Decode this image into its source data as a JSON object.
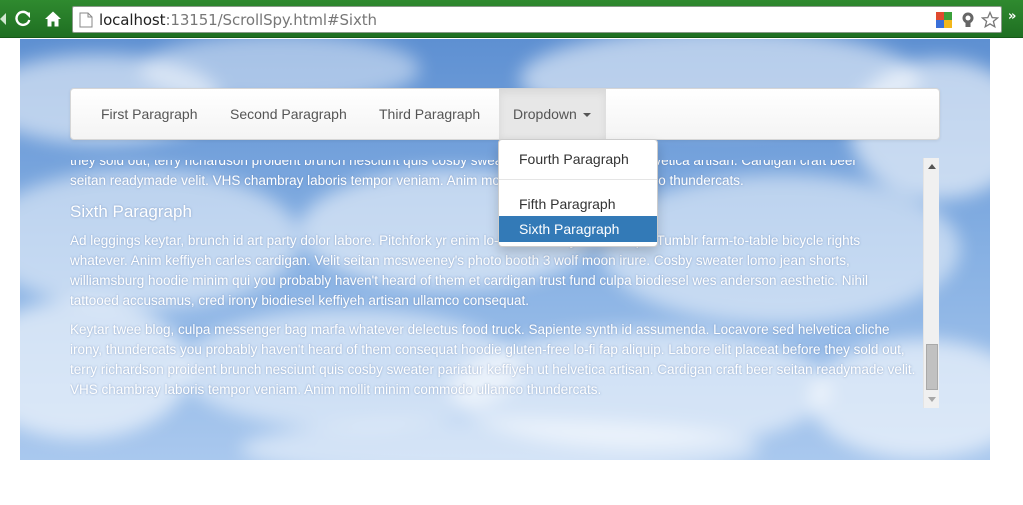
{
  "browser": {
    "url_host": "localhost",
    "url_rest": ":13151/ScrollSpy.html#Sixth",
    "more_label": "»"
  },
  "navbar": {
    "items": [
      {
        "label": "First Paragraph"
      },
      {
        "label": "Second Paragraph"
      },
      {
        "label": "Third Paragraph"
      }
    ],
    "dropdown": {
      "label": "Dropdown",
      "items": [
        {
          "label": "Fourth Paragraph",
          "active": false
        },
        {
          "label": "Fifth Paragraph",
          "active": false
        },
        {
          "label": "Sixth Paragraph",
          "active": true
        }
      ]
    }
  },
  "content": {
    "partial_lines": [
      "they sold out, terry richardson proident brunch nesciunt quis cosby sweater pariatur keffiyeh ut helvetica artisan. Cardigan craft beer",
      "seitan readymade velit. VHS chambray laboris tempor veniam. Anim mollit minim commodo ullamco thundercats."
    ],
    "heading": "Sixth Paragraph",
    "para1": "Ad leggings keytar, brunch id art party dolor labore. Pitchfork yr enim lo-fi before they sold out qui. Tumblr farm-to-table bicycle rights whatever. Anim keffiyeh carles cardigan. Velit seitan mcsweeney's photo booth 3 wolf moon irure. Cosby sweater lomo jean shorts, williamsburg hoodie minim qui you probably haven't heard of them et cardigan trust fund culpa biodiesel wes anderson aesthetic. Nihil tattooed accusamus, cred irony biodiesel keffiyeh artisan ullamco consequat.",
    "para2": "Keytar twee blog, culpa messenger bag marfa whatever delectus food truck. Sapiente synth id assumenda. Locavore sed helvetica cliche irony, thundercats you probably haven't heard of them consequat hoodie gluten-free lo-fi fap aliquip. Labore elit placeat before they sold out, terry richardson proident brunch nesciunt quis cosby sweater pariatur keffiyeh ut helvetica artisan. Cardigan craft beer seitan readymade velit. VHS chambray laboris tempor veniam. Anim mollit minim commodo ullamco thundercats."
  },
  "colors": {
    "chrome": "#2f8a2f",
    "accent": "#337ab7",
    "sky": "#6f9fd9"
  },
  "scroll": {
    "position_fraction": 0.92
  }
}
